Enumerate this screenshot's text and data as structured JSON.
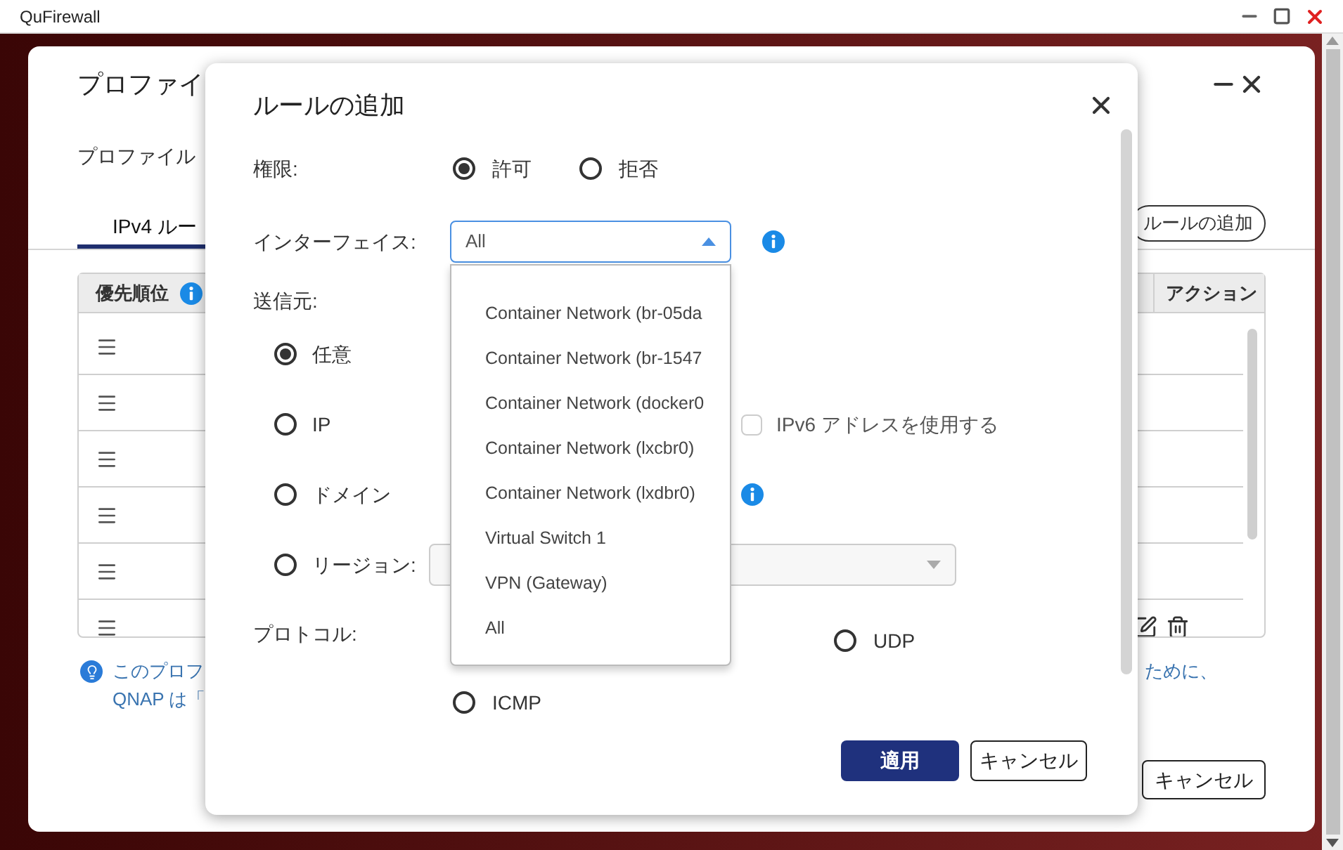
{
  "window": {
    "title": "QuFirewall"
  },
  "profile_panel": {
    "title": "プロファイ",
    "subtitle": "プロファイル",
    "tabs": [
      {
        "label": "IPv4 ルー",
        "selected": true
      }
    ],
    "add_rule_button": "ルールの追加",
    "table": {
      "columns": [
        "優先順位",
        "アクション"
      ],
      "rows": [
        {
          "kind": "plain"
        },
        {
          "kind": "plain"
        },
        {
          "kind": "plain"
        },
        {
          "kind": "plain"
        },
        {
          "kind": "plain"
        },
        {
          "kind": "actions"
        }
      ]
    },
    "tip": {
      "lines": [
        "このプロフ",
        "QNAP は「"
      ],
      "tail": "ために、"
    },
    "cancel_button": "キャンセル"
  },
  "dialog": {
    "title": "ルールの追加",
    "permission": {
      "label": "権限:",
      "options": [
        {
          "label": "許可",
          "selected": true
        },
        {
          "label": "拒否",
          "selected": false
        }
      ]
    },
    "interface": {
      "label": "インターフェイス:",
      "value": "All",
      "expanded": true,
      "options": [
        "Container Network (br-05da",
        "Container Network (br-1547",
        "Container Network (docker0",
        "Container Network (lxcbr0)",
        "Container Network (lxdbr0)",
        "Virtual Switch 1",
        "VPN (Gateway)",
        "All"
      ]
    },
    "source": {
      "label": "送信元:",
      "options": [
        {
          "label": "任意",
          "selected": true,
          "kind": "any"
        },
        {
          "label": "IP",
          "selected": false,
          "kind": "ip"
        },
        {
          "label": "ドメイン",
          "selected": false,
          "kind": "domain"
        },
        {
          "label": "リージョン:",
          "selected": false,
          "kind": "region"
        }
      ],
      "ipv6": {
        "label": "IPv6 アドレスを使用する",
        "checked": false
      }
    },
    "protocol": {
      "label": "プロトコル:",
      "options": [
        {
          "label": "UDP",
          "selected": false
        },
        {
          "label": "ICMP",
          "selected": false
        }
      ]
    },
    "buttons": [
      {
        "label": "適用",
        "kind": "primary"
      },
      {
        "label": "キャンセル",
        "kind": "secondary"
      }
    ]
  }
}
